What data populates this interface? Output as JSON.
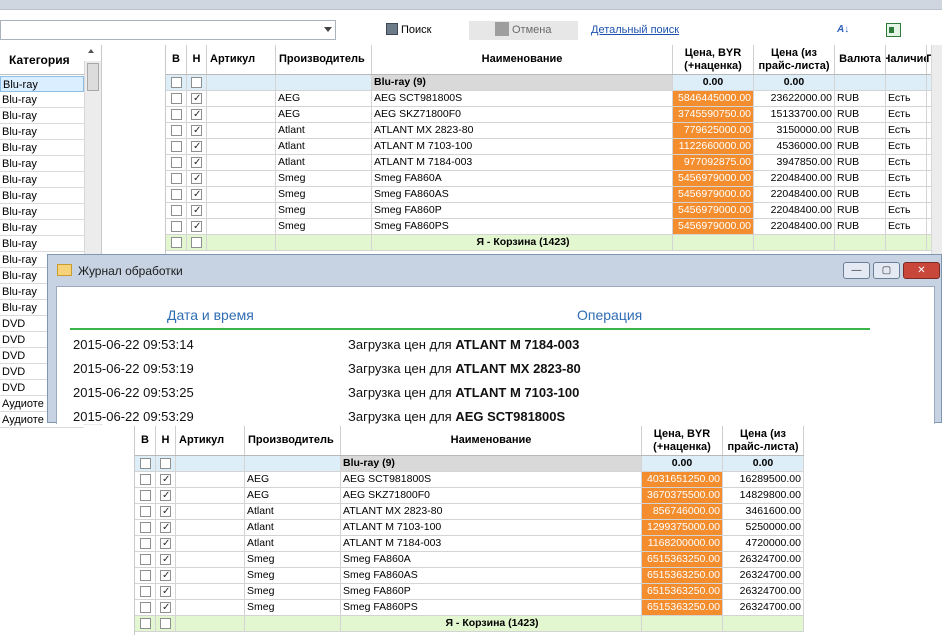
{
  "toolbar": {
    "search_label": "Поиск",
    "cancel_label": "Отмена",
    "detail_search_link": "Детальный поиск"
  },
  "category_panel": {
    "header": "Категория",
    "items": [
      "Blu-ray",
      "Blu-ray",
      "Blu-ray",
      "Blu-ray",
      "Blu-ray",
      "Blu-ray",
      "Blu-ray",
      "Blu-ray",
      "Blu-ray",
      "Blu-ray",
      "Blu-ray",
      "Blu-ray",
      "Blu-ray",
      "Blu-ray",
      "Blu-ray",
      "DVD",
      "DVD",
      "DVD",
      "DVD",
      "DVD",
      "Аудиоте",
      "Аудиоте"
    ]
  },
  "grid_main": {
    "headers": [
      "В",
      "Н",
      "Артикул",
      "Производитель",
      "Наименование",
      "Цена, BYR\n(+наценка)",
      "Цена (из\nпрайс-листа)",
      "Валюта",
      "Наличие",
      "Пр"
    ],
    "group1": {
      "name": "Blu-ray (9)",
      "price": "0.00",
      "list_price": "0.00"
    },
    "rows": [
      {
        "h": true,
        "maker": "AEG",
        "name": "AEG SCT981800S",
        "price": "5846445000.00",
        "list": "23622000.00",
        "cur": "RUB",
        "avail": "Есть"
      },
      {
        "h": true,
        "maker": "AEG",
        "name": "AEG SKZ71800F0",
        "price": "3745590750.00",
        "list": "15133700.00",
        "cur": "RUB",
        "avail": "Есть"
      },
      {
        "h": true,
        "maker": "Atlant",
        "name": "ATLANT MX 2823-80",
        "price": "779625000.00",
        "list": "3150000.00",
        "cur": "RUB",
        "avail": "Есть"
      },
      {
        "h": true,
        "maker": "Atlant",
        "name": "ATLANT M 7103-100",
        "price": "1122660000.00",
        "list": "4536000.00",
        "cur": "RUB",
        "avail": "Есть"
      },
      {
        "h": true,
        "maker": "Atlant",
        "name": "ATLANT M 7184-003",
        "price": "977092875.00",
        "list": "3947850.00",
        "cur": "RUB",
        "avail": "Есть"
      },
      {
        "h": true,
        "maker": "Smeg",
        "name": "Smeg FA860A",
        "price": "5456979000.00",
        "list": "22048400.00",
        "cur": "RUB",
        "avail": "Есть"
      },
      {
        "h": true,
        "maker": "Smeg",
        "name": "Smeg FA860AS",
        "price": "5456979000.00",
        "list": "22048400.00",
        "cur": "RUB",
        "avail": "Есть"
      },
      {
        "h": true,
        "maker": "Smeg",
        "name": "Smeg FA860P",
        "price": "5456979000.00",
        "list": "22048400.00",
        "cur": "RUB",
        "avail": "Есть"
      },
      {
        "h": true,
        "maker": "Smeg",
        "name": "Smeg FA860PS",
        "price": "5456979000.00",
        "list": "22048400.00",
        "cur": "RUB",
        "avail": "Есть"
      }
    ],
    "group2": {
      "name": "Я - Корзина (1423)"
    }
  },
  "dialog": {
    "title": "Журнал обработки",
    "col_datetime": "Дата и время",
    "col_operation": "Операция",
    "entries": [
      {
        "time": "2015-06-22 09:53:14",
        "prefix": "Загрузка цен для ",
        "item": "ATLANT M 7184-003"
      },
      {
        "time": "2015-06-22 09:53:19",
        "prefix": "Загрузка цен для ",
        "item": "ATLANT MX 2823-80"
      },
      {
        "time": "2015-06-22 09:53:25",
        "prefix": "Загрузка цен для ",
        "item": "ATLANT M 7103-100"
      },
      {
        "time": "2015-06-22 09:53:29",
        "prefix": "Загрузка цен для ",
        "item": "AEG SCT981800S"
      }
    ]
  },
  "grid_bottom": {
    "headers": [
      "В",
      "Н",
      "Артикул",
      "Производитель",
      "Наименование",
      "Цена, BYR\n(+наценка)",
      "Цена (из\nпрайс-листа)"
    ],
    "group1": {
      "name": "Blu-ray (9)",
      "price": "0.00",
      "list_price": "0.00"
    },
    "rows": [
      {
        "h": true,
        "maker": "AEG",
        "name": "AEG SCT981800S",
        "price": "4031651250.00",
        "list": "16289500.00"
      },
      {
        "h": true,
        "maker": "AEG",
        "name": "AEG SKZ71800F0",
        "price": "3670375500.00",
        "list": "14829800.00"
      },
      {
        "h": true,
        "maker": "Atlant",
        "name": "ATLANT MX 2823-80",
        "price": "856746000.00",
        "list": "3461600.00"
      },
      {
        "h": true,
        "maker": "Atlant",
        "name": "ATLANT M 7103-100",
        "price": "1299375000.00",
        "list": "5250000.00"
      },
      {
        "h": true,
        "maker": "Atlant",
        "name": "ATLANT M 7184-003",
        "price": "1168200000.00",
        "list": "4720000.00"
      },
      {
        "h": true,
        "maker": "Smeg",
        "name": "Smeg FA860A",
        "price": "6515363250.00",
        "list": "26324700.00"
      },
      {
        "h": true,
        "maker": "Smeg",
        "name": "Smeg FA860AS",
        "price": "6515363250.00",
        "list": "26324700.00"
      },
      {
        "h": true,
        "maker": "Smeg",
        "name": "Smeg FA860P",
        "price": "6515363250.00",
        "list": "26324700.00"
      },
      {
        "h": true,
        "maker": "Smeg",
        "name": "Smeg FA860PS",
        "price": "6515363250.00",
        "list": "26324700.00"
      }
    ],
    "group2": {
      "name": "Я - Корзина (1423)"
    }
  }
}
